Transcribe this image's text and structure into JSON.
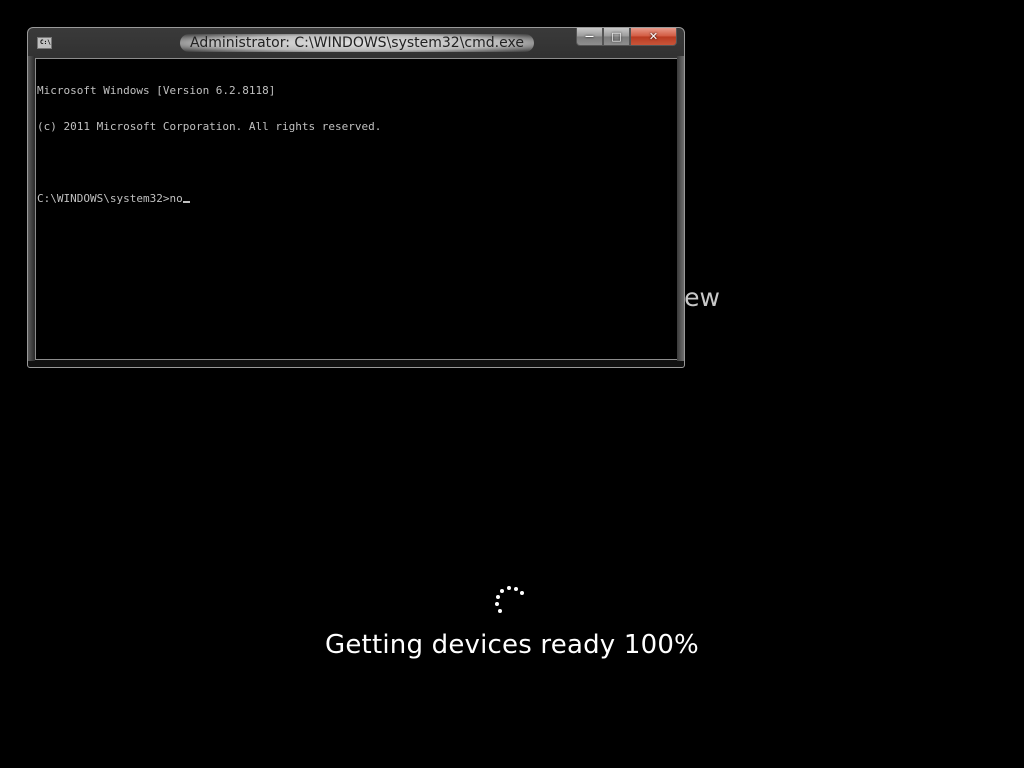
{
  "background": {
    "partial_text": "ew",
    "status_text": "Getting devices ready 100%"
  },
  "window": {
    "title": "Administrator: C:\\WINDOWS\\system32\\cmd.exe",
    "icon_label": "C:\\",
    "caption": {
      "minimize": "—",
      "maximize": "□",
      "close": "✕"
    },
    "console": {
      "line1": "Microsoft Windows [Version 6.2.8118]",
      "line2": "(c) 2011 Microsoft Corporation. All rights reserved.",
      "line3": "",
      "prompt": "C:\\WINDOWS\\system32>",
      "input": "no"
    }
  }
}
